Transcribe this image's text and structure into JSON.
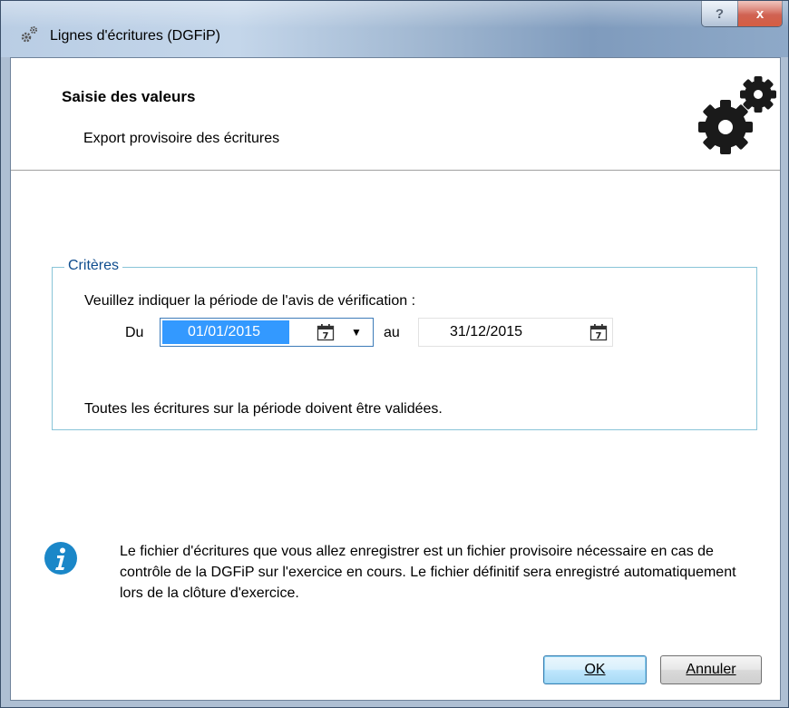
{
  "window": {
    "title": "Lignes d'écritures (DGFiP)",
    "help_glyph": "?",
    "close_glyph": "x"
  },
  "header": {
    "title": "Saisie des valeurs",
    "subtitle": "Export provisoire des écritures",
    "icon": "gears-icon"
  },
  "criteria": {
    "legend": "Critères",
    "prompt": "Veuillez indiquer la période de l'avis de vérification :",
    "from_label": "Du",
    "from_value": "01/01/2015",
    "to_label": "au",
    "to_value": "31/12/2015",
    "note": "Toutes les écritures sur la période doivent être validées.",
    "calendar_day": "7"
  },
  "info": {
    "icon": "info-icon",
    "text": "Le fichier d'écritures que vous allez enregistrer est un fichier provisoire nécessaire en cas de contrôle de la DGFiP sur l'exercice en cours. Le fichier définitif sera enregistré automatiquement lors de la clôture d'exercice."
  },
  "buttons": {
    "ok": "OK",
    "cancel": "Annuler"
  },
  "colors": {
    "selection": "#3399ff",
    "group_border": "#89c4d8",
    "legend_text": "#0e4c8e",
    "info_blue": "#1b87c8"
  }
}
